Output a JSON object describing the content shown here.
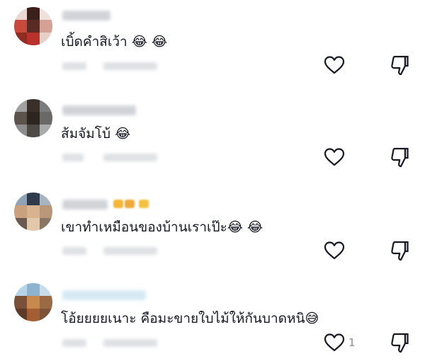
{
  "comments": [
    {
      "text": "เบิ้ดคำสิเว้า 😂 😂",
      "like_count": ""
    },
    {
      "text": "ส้มจัมโบ้ 😂",
      "like_count": ""
    },
    {
      "text": "เขาทำเหมือนของบ้านเราเป๊ะ😂 😂",
      "like_count": ""
    },
    {
      "text": "โอ้ยยยยเนาะ คือมะขายใบไม้ให้กันบาดหนิ😅",
      "like_count": "1"
    }
  ],
  "icons": {
    "like": "heart-outline-icon",
    "dislike": "thumbs-down-outline-icon"
  },
  "colors": {
    "text": "#161823",
    "icon": "#161823",
    "count": "#8a8b91",
    "blur": "#c9ccd1"
  }
}
